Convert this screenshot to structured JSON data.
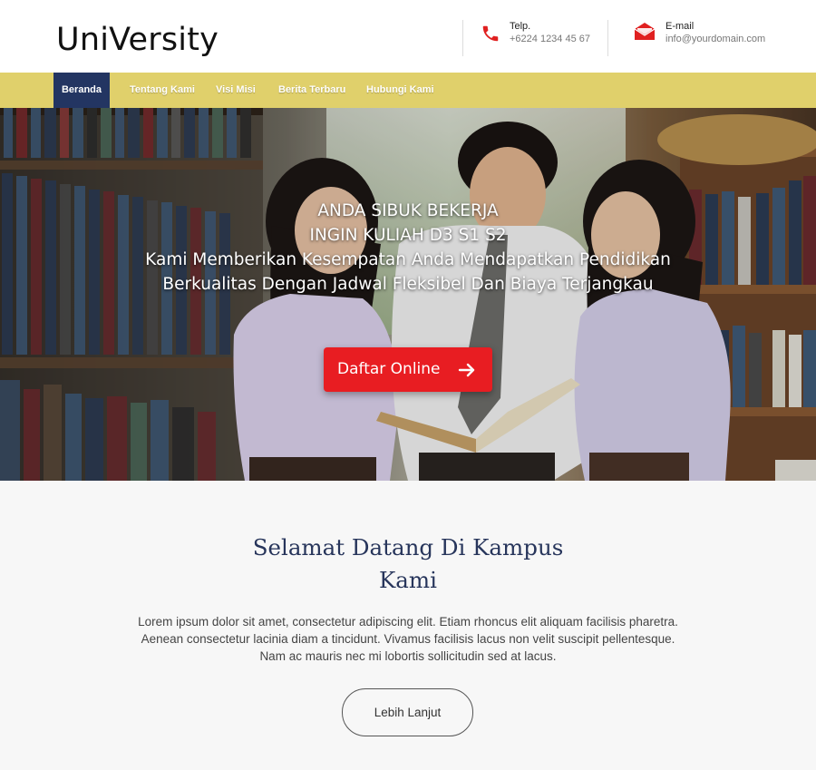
{
  "header": {
    "logo": "UniVersity",
    "phone": {
      "label": "Telp.",
      "value": "+6224 1234 45 67",
      "icon": "phone-icon"
    },
    "email": {
      "label": "E-mail",
      "value": "info@yourdomain.com",
      "icon": "envelope-icon"
    }
  },
  "nav": {
    "items": [
      {
        "label": "Beranda",
        "active": true
      },
      {
        "label": "Tentang Kami"
      },
      {
        "label": "Visi Misi"
      },
      {
        "label": "Berita Terbaru"
      },
      {
        "label": "Hubungi Kami"
      }
    ]
  },
  "hero": {
    "line1": "ANDA SIBUK BEKERJA",
    "line2": "INGIN KULIAH D3 S1 S2",
    "line3": "Kami Memberikan Kesempatan Anda Mendapatkan Pendidikan",
    "line4": "Berkualitas Dengan Jadwal Fleksibel Dan Biaya Terjangkau",
    "cta_label": "Daftar Online"
  },
  "welcome": {
    "title_line1": "Selamat Datang Di Kampus",
    "title_line2": "Kami",
    "body_line1": "Lorem ipsum dolor sit amet, consectetur adipiscing elit. Etiam rhoncus elit aliquam facilisis pharetra.",
    "body_line2": "Aenean consectetur lacinia diam a tincidunt. Vivamus facilisis lacus non velit suscipit pellentesque.",
    "body_line3": "Nam ac mauris nec mi lobortis sollicitudin sed at lacus.",
    "button_label": "Lebih Lanjut"
  },
  "colors": {
    "nav_bg": "#e0d06b",
    "nav_active": "#233562",
    "cta": "#e81d22",
    "title": "#27355b",
    "icon_red": "#e02020"
  }
}
